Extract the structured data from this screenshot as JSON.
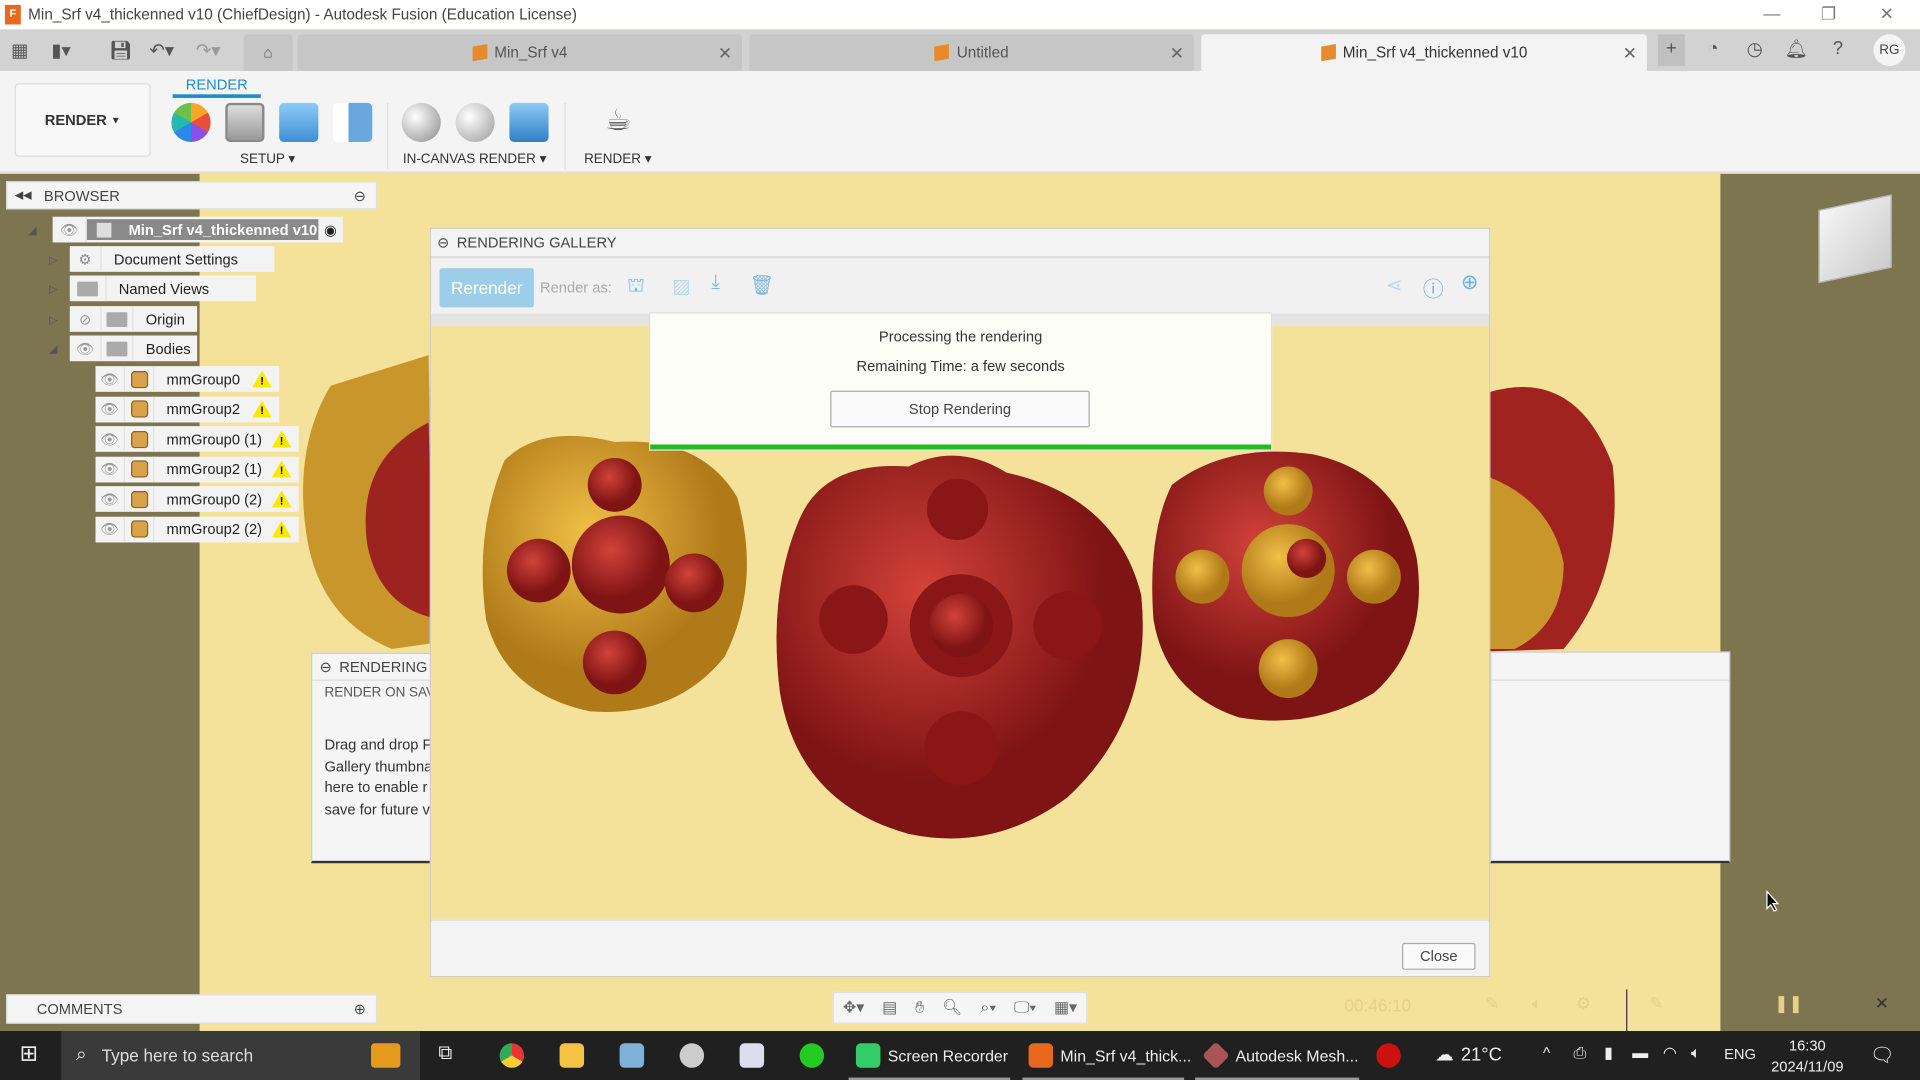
{
  "window": {
    "title": "Min_Srf v4_thickenned v10 (ChiefDesign) - Autodesk Fusion (Education License)",
    "app_icon_letter": "F"
  },
  "tabs": [
    {
      "label": "Min_Srf v4",
      "active": false
    },
    {
      "label": "Untitled",
      "active": false
    },
    {
      "label": "Min_Srf v4_thickenned v10",
      "active": true
    }
  ],
  "user": {
    "initials": "RG"
  },
  "toolbar": {
    "workspace": "RENDER",
    "tab": "RENDER",
    "groups": [
      {
        "label": "SETUP ▾"
      },
      {
        "label": "IN-CANVAS RENDER ▾"
      },
      {
        "label": "RENDER ▾"
      }
    ]
  },
  "browser": {
    "title": "BROWSER",
    "root": "Min_Srf v4_thickenned v10",
    "items": [
      "Document Settings",
      "Named Views",
      "Origin",
      "Bodies"
    ],
    "bodies": [
      "mmGroup0",
      "mmGroup2",
      "mmGroup0 (1)",
      "mmGroup2 (1)",
      "mmGroup0 (2)",
      "mmGroup2 (2)"
    ]
  },
  "gallery": {
    "title": "RENDERING GALLERY",
    "rerender": "Rerender",
    "render_as": "Render as:",
    "close": "Close"
  },
  "processing": {
    "line1": "Processing the rendering",
    "line2": "Remaining Time: a few seconds",
    "stop": "Stop Rendering",
    "progress_percent": 100,
    "progress_color": "#22bb22"
  },
  "render_settings": {
    "title": "RENDERING",
    "subtitle": "RENDER ON SAVE",
    "text": [
      "Drag and drop F",
      "Gallery thumbna",
      "here to enable r",
      "save for future v"
    ]
  },
  "comments": {
    "title": "COMMENTS"
  },
  "timeline": {
    "time": "00:46:10"
  },
  "colors": {
    "viewport": "#f5e29a",
    "accent": "#1a8ecf",
    "body_red": "#a3201f",
    "body_gold": "#d9a52b"
  },
  "taskbar": {
    "search_placeholder": "Type here to search",
    "apps": [
      "Screen Recorder",
      "Min_Srf v4_thick...",
      "Autodesk Mesh..."
    ],
    "weather": "21°C",
    "lang": "ENG",
    "time": "16:30",
    "date": "2024/11/09"
  }
}
